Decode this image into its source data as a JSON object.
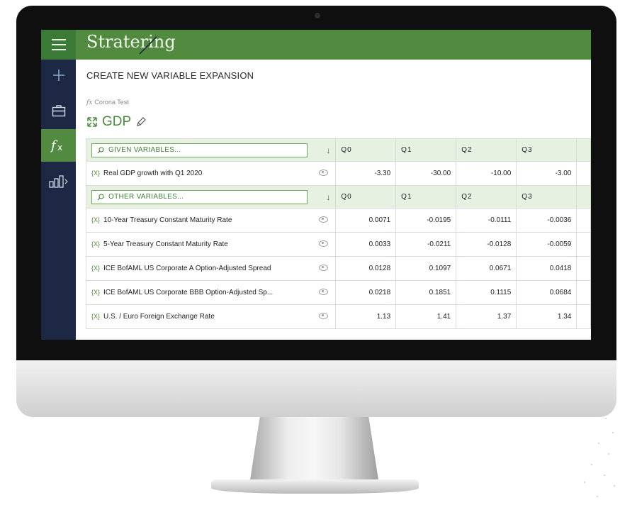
{
  "app": {
    "brand": "Stratering"
  },
  "page": {
    "title": "CREATE NEW VARIABLE EXPANSION",
    "breadcrumb": "Corona Test",
    "variable_name": "GDP"
  },
  "icons": {
    "menu": "hamburger-icon",
    "add": "plus-icon",
    "briefcase": "briefcase-icon",
    "fx": "function-icon",
    "chart": "bar-chart-icon",
    "expand": "expand-icon",
    "edit": "pencil-icon",
    "search": "search-icon",
    "sort": "sort-down-icon",
    "eye": "eye-icon"
  },
  "colors": {
    "brand_green": "#528b3f",
    "sidebar_navy": "#1d2844",
    "header_green": "#e7f1e2"
  },
  "given": {
    "search_label": "GIVEN VARIABLES...",
    "columns": [
      "Q0",
      "Q1",
      "Q2",
      "Q3"
    ],
    "rows": [
      {
        "name": "Real GDP growth with Q1 2020",
        "values": [
          "-3.30",
          "-30.00",
          "-10.00",
          "-3.00"
        ]
      }
    ]
  },
  "other": {
    "search_label": "OTHER VARIABLES...",
    "columns": [
      "Q0",
      "Q1",
      "Q2",
      "Q3"
    ],
    "rows": [
      {
        "name": "10-Year Treasury Constant Maturity Rate",
        "values": [
          "0.0071",
          "-0.0195",
          "-0.0111",
          "-0.0036"
        ]
      },
      {
        "name": "5-Year Treasury Constant Maturity Rate",
        "values": [
          "0.0033",
          "-0.0211",
          "-0.0128",
          "-0.0059"
        ]
      },
      {
        "name": "ICE BofAML US Corporate A Option-Adjusted Spread",
        "values": [
          "0.0128",
          "0.1097",
          "0.0671",
          "0.0418"
        ]
      },
      {
        "name": "ICE BofAML US Corporate BBB Option-Adjusted Sp...",
        "values": [
          "0.0218",
          "0.1851",
          "0.1115",
          "0.0684"
        ]
      },
      {
        "name": "U.S. / Euro Foreign Exchange Rate",
        "values": [
          "1.13",
          "1.41",
          "1.37",
          "1.34"
        ]
      }
    ]
  }
}
